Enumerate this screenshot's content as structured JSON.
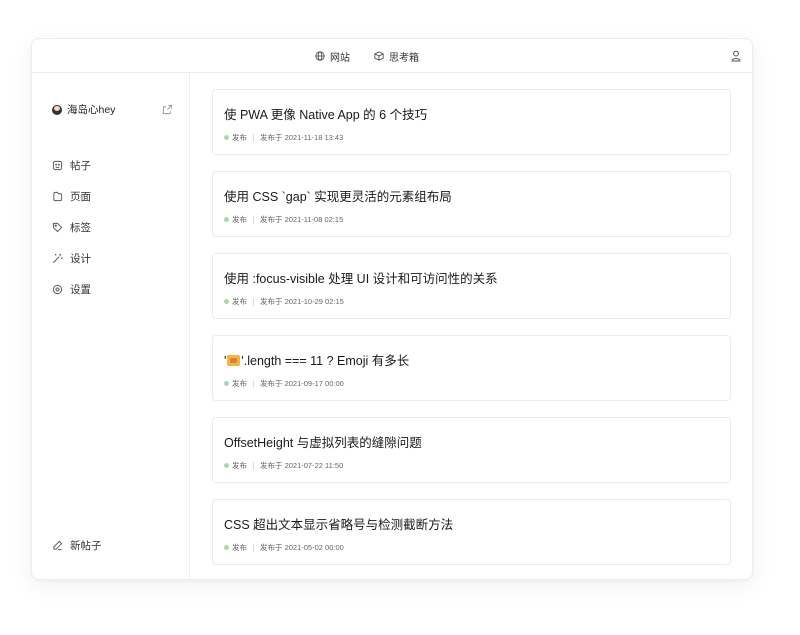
{
  "topbar": {
    "nav": [
      {
        "icon": "globe-icon",
        "label": "网站"
      },
      {
        "icon": "box-icon",
        "label": "思考箱"
      }
    ],
    "user_icon": "user-icon"
  },
  "sidebar": {
    "profile": {
      "name": "海岛心hey",
      "avatar": "avatar",
      "action_icon": "external-link-icon"
    },
    "items": [
      {
        "icon": "post-icon",
        "label": "帖子"
      },
      {
        "icon": "page-icon",
        "label": "页面"
      },
      {
        "icon": "tag-icon",
        "label": "标签"
      },
      {
        "icon": "magic-wand-icon",
        "label": "设计"
      },
      {
        "icon": "settings-icon",
        "label": "设置"
      }
    ],
    "new_post": {
      "icon": "edit-icon",
      "label": "新帖子"
    }
  },
  "posts": [
    {
      "title": "使 PWA 更像 Native App 的 6 个技巧",
      "status": "发布",
      "published": "发布于 2021-11-18 13:43"
    },
    {
      "title": "使用 CSS `gap` 实现更灵活的元素组布局",
      "status": "发布",
      "published": "发布于 2021-11-08 02:15"
    },
    {
      "title": "使用 :focus-visible 处理 UI 设计和可访问性的关系",
      "status": "发布",
      "published": "发布于 2021-10-29 02:15"
    },
    {
      "title_prefix": "'",
      "title_emoji": "family-emoji",
      "title": "'.length === 11 ? Emoji 有多长",
      "status": "发布",
      "published": "发布于 2021-09-17 00:00"
    },
    {
      "title": "OffsetHeight 与虚拟列表的缝隙问题",
      "status": "发布",
      "published": "发布于 2021-07-22 11:50"
    },
    {
      "title": "CSS 超出文本显示省略号与检测截断方法",
      "status": "发布",
      "published": "发布于 2021-05-02 00:00"
    }
  ],
  "colors": {
    "status_published": "#a8d8b0",
    "border": "#ebebeb",
    "text": "#1a1a1a"
  }
}
